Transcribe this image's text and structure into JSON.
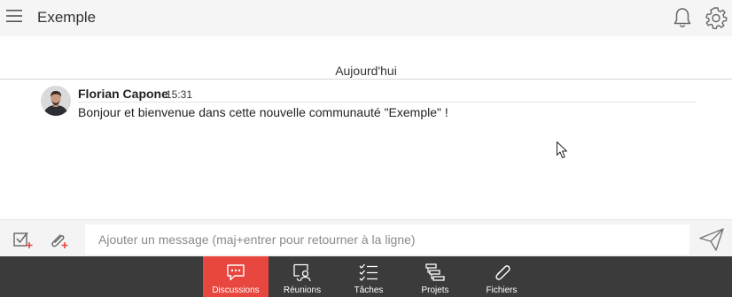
{
  "header": {
    "title": "Exemple",
    "icons": [
      "menu-icon",
      "bell-icon",
      "gear-icon"
    ]
  },
  "messages": {
    "date_separator": "Aujourd'hui",
    "items": [
      {
        "author": "Florian Capone",
        "time": "15:31",
        "text": "Bonjour et bienvenue dans cette nouvelle communauté \"Exemple\" !"
      }
    ]
  },
  "composer": {
    "placeholder": "Ajouter un message (maj+entrer pour retourner à la ligne)",
    "value": "",
    "icons": [
      "task-check-icon",
      "attach-plus-icon",
      "send-icon"
    ]
  },
  "nav": {
    "items": [
      {
        "label": "Discussions",
        "icon": "chat-bubble-icon",
        "active": true
      },
      {
        "label": "Réunions",
        "icon": "meeting-icon",
        "active": false
      },
      {
        "label": "Tâches",
        "icon": "checklist-icon",
        "active": false
      },
      {
        "label": "Projets",
        "icon": "gantt-icon",
        "active": false
      },
      {
        "label": "Fichiers",
        "icon": "paperclip-icon",
        "active": false
      }
    ]
  },
  "colors": {
    "accent": "#e8473f",
    "nav_background": "#3b3b3b",
    "header_background": "#f5f5f5"
  }
}
